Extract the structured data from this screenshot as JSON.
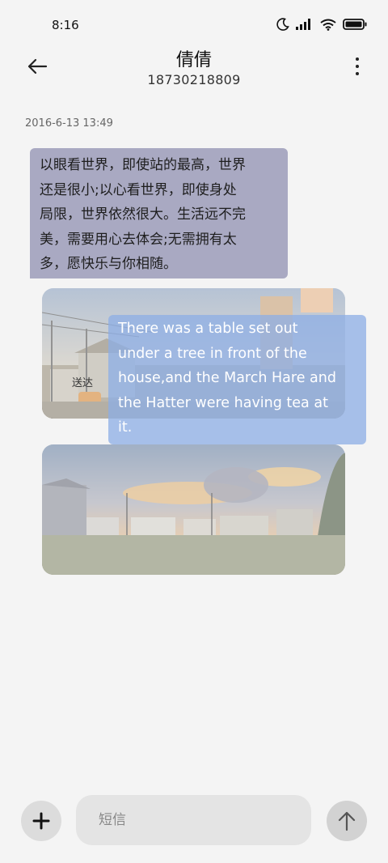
{
  "status_bar": {
    "time": "8:16",
    "icons": [
      "moon-icon",
      "signal-icon",
      "wifi-icon",
      "battery-icon"
    ]
  },
  "header": {
    "title": "倩倩",
    "phone": "18730218809"
  },
  "conversation": {
    "timestamp": "2016-6-13 13:49",
    "messages": [
      {
        "type": "text",
        "direction": "incoming",
        "lines": [
          "以眼看世界，即使站的最高，世界",
          "还是很小;以心看世界，即使身处",
          "局限，世界依然很大。生活远不完",
          "美，需要用心去体会;无需拥有太",
          "多，愿快乐与你相随。"
        ]
      },
      {
        "type": "image",
        "direction": "outgoing",
        "status": "送达"
      },
      {
        "type": "text",
        "direction": "outgoing",
        "lines": [
          "There was a table set out",
          "under a tree in front of the",
          "house,and the March Hare and",
          "the Hatter were having tea at",
          "it."
        ]
      },
      {
        "type": "image",
        "direction": "outgoing"
      }
    ]
  },
  "composer": {
    "placeholder": "短信",
    "value": "",
    "add_icon": "plus-icon",
    "send_icon": "arrow-up-icon"
  },
  "colors": {
    "background": "#f4f4f4",
    "incoming_bubble": "#a9a9c2",
    "outgoing_bubble": "#8caee6"
  }
}
